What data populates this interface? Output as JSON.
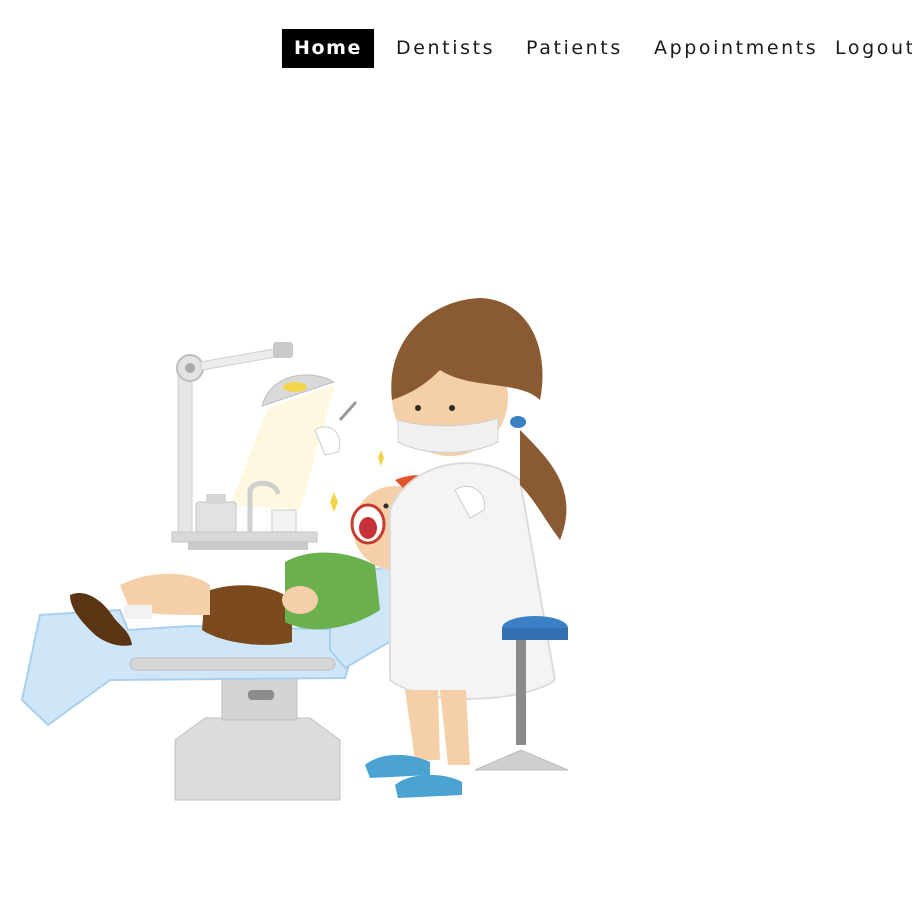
{
  "nav": {
    "items": [
      {
        "label": "Home",
        "active": true
      },
      {
        "label": "Dentists",
        "active": false
      },
      {
        "label": "Patients",
        "active": false
      },
      {
        "label": "Appointments",
        "active": false
      },
      {
        "label": "Logout",
        "active": false
      }
    ]
  },
  "colors": {
    "active_tab_bg": "#000000",
    "active_tab_text": "#ffffff",
    "nav_text": "#1a1a1a",
    "page_bg": "#ffffff",
    "chair": "#cfe6f8",
    "dentist_hair": "#8a5a32",
    "coat": "#f4f4f4",
    "patient_shirt": "#6ab04c",
    "patient_hair": "#e2542a",
    "stool_seat": "#3b7fc4",
    "shoes": "#4aa3d1"
  },
  "illustration": {
    "icon": "dentist-with-child-patient-illustration"
  }
}
